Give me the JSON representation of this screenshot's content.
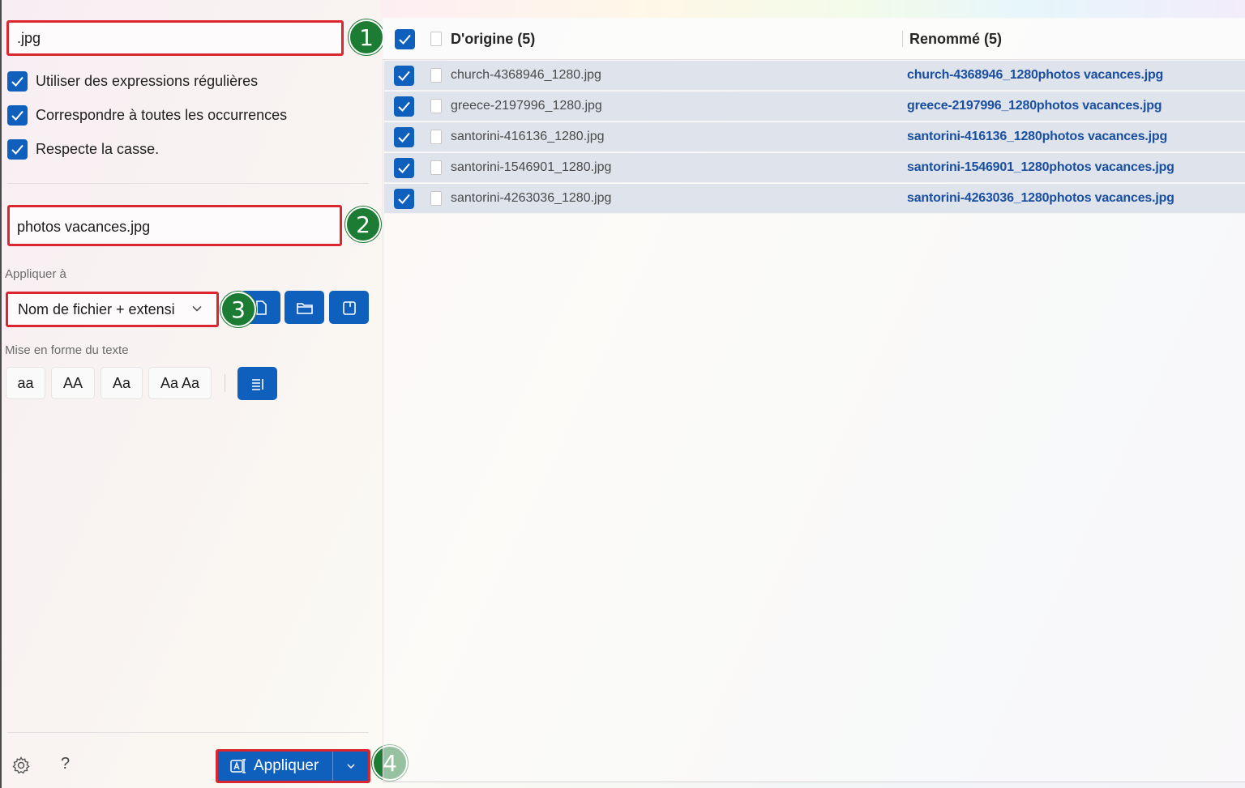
{
  "search": {
    "value": ".jpg"
  },
  "options": {
    "regex_label": "Utiliser des expressions régulières",
    "match_all_label": "Correspondre à toutes les occurrences",
    "case_sensitive_label": "Respecte la casse."
  },
  "replace": {
    "value": "photos vacances.jpg"
  },
  "apply_to": {
    "label": "Appliquer à",
    "selected": "Nom de fichier + extension",
    "icons": [
      "file-icon",
      "folder-icon",
      "subfolder-icon"
    ]
  },
  "text_format": {
    "label": "Mise en forme du texte",
    "buttons": [
      "aa",
      "AA",
      "Aa",
      "Aa Aa"
    ],
    "enumerate_icon": "list-enumerate-icon"
  },
  "footer": {
    "help": "?",
    "apply_label": "Appliquer"
  },
  "badges": [
    "1",
    "2",
    "3",
    "4"
  ],
  "file_list": {
    "original_header": "D'origine (5)",
    "renamed_header": "Renommé (5)",
    "rows": [
      {
        "original": "church-4368946_1280.jpg",
        "renamed": "church-4368946_1280photos vacances.jpg"
      },
      {
        "original": "greece-2197996_1280.jpg",
        "renamed": "greece-2197996_1280photos vacances.jpg"
      },
      {
        "original": "santorini-416136_1280.jpg",
        "renamed": "santorini-416136_1280photos vacances.jpg"
      },
      {
        "original": "santorini-1546901_1280.jpg",
        "renamed": "santorini-1546901_1280photos vacances.jpg"
      },
      {
        "original": "santorini-4263036_1280.jpg",
        "renamed": "santorini-4263036_1280photos vacances.jpg"
      }
    ]
  },
  "colors": {
    "accent": "#0f5fbd",
    "highlight_border": "#d9262f",
    "badge": "#1c7c34",
    "renamed_text": "#1a4fa0"
  }
}
